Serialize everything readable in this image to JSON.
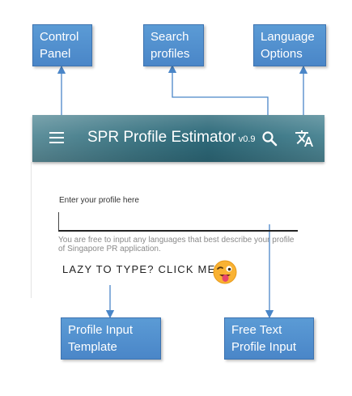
{
  "callouts": {
    "control_panel": [
      "Control",
      "Panel"
    ],
    "search_profiles": [
      "Search",
      "profiles"
    ],
    "language_options": [
      "Language",
      "Options"
    ],
    "profile_input_template": [
      "Profile Input",
      "Template"
    ],
    "free_text_input": [
      "Free Text",
      "Profile Input"
    ]
  },
  "app_bar": {
    "title": "SPR Profile Estimator",
    "version": "v0.9",
    "menu_icon": "menu-icon",
    "search_icon": "search-icon",
    "language_icon": "translate-icon"
  },
  "form": {
    "label": "Enter your profile here",
    "value": "",
    "helper": "You are free to input any languages that best describe your profile of Singapore PR application.",
    "lazy_button": "LAZY TO TYPE? CLICK ME",
    "lazy_icon": "winking-tongue-emoji-icon"
  },
  "colors": {
    "callout": "#5b9bd5",
    "arrow": "#4a86c8",
    "app_bar": "#3f7886"
  }
}
